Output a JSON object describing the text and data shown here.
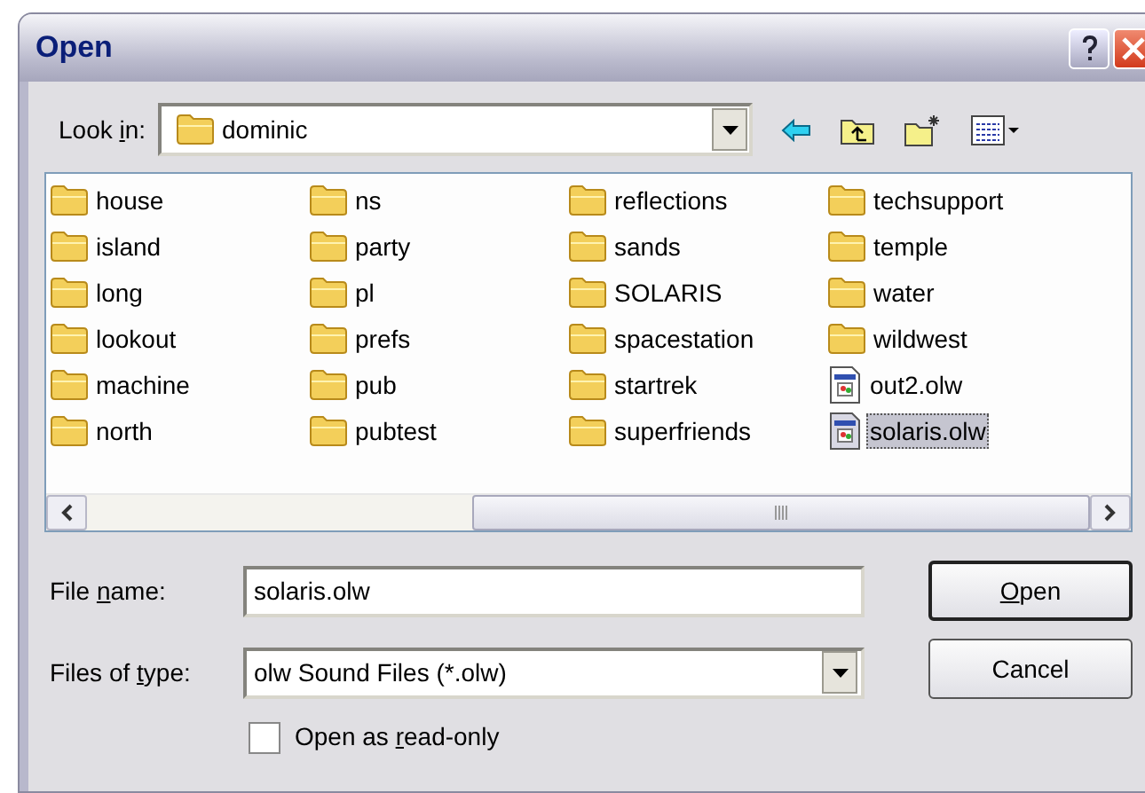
{
  "window": {
    "title": "Open"
  },
  "look_in": {
    "label_start": "Look ",
    "access_key": "i",
    "label_end": "n:",
    "value": "dominic"
  },
  "files": [
    {
      "name": "house",
      "kind": "folder",
      "selected": false
    },
    {
      "name": "island",
      "kind": "folder",
      "selected": false
    },
    {
      "name": "long",
      "kind": "folder",
      "selected": false
    },
    {
      "name": "lookout",
      "kind": "folder",
      "selected": false
    },
    {
      "name": "machine",
      "kind": "folder",
      "selected": false
    },
    {
      "name": "north",
      "kind": "folder",
      "selected": false
    },
    {
      "name": "ns",
      "kind": "folder",
      "selected": false
    },
    {
      "name": "party",
      "kind": "folder",
      "selected": false
    },
    {
      "name": "pl",
      "kind": "folder",
      "selected": false
    },
    {
      "name": "prefs",
      "kind": "folder",
      "selected": false
    },
    {
      "name": "pub",
      "kind": "folder",
      "selected": false
    },
    {
      "name": "pubtest",
      "kind": "folder",
      "selected": false
    },
    {
      "name": "reflections",
      "kind": "folder",
      "selected": false
    },
    {
      "name": "sands",
      "kind": "folder",
      "selected": false
    },
    {
      "name": "SOLARIS",
      "kind": "folder",
      "selected": false
    },
    {
      "name": "spacestation",
      "kind": "folder",
      "selected": false
    },
    {
      "name": "startrek",
      "kind": "folder",
      "selected": false
    },
    {
      "name": "superfriends",
      "kind": "folder",
      "selected": false
    },
    {
      "name": "techsupport",
      "kind": "folder",
      "selected": false
    },
    {
      "name": "temple",
      "kind": "folder",
      "selected": false
    },
    {
      "name": "water",
      "kind": "folder",
      "selected": false
    },
    {
      "name": "wildwest",
      "kind": "folder",
      "selected": false
    },
    {
      "name": "out2.olw",
      "kind": "file",
      "selected": false
    },
    {
      "name": "solaris.olw",
      "kind": "file",
      "selected": true
    }
  ],
  "file_name": {
    "label_start": "File ",
    "access_key": "n",
    "label_end": "ame:",
    "value": "solaris.olw"
  },
  "file_type": {
    "label_start": "Files of ",
    "access_key": "t",
    "label_end": "ype:",
    "value": "olw Sound Files (*.olw)"
  },
  "read_only": {
    "label_start": "Open as ",
    "access_key": "r",
    "label_end": "ead-only",
    "checked": false
  },
  "buttons": [
    {
      "access_key": "O",
      "label_end": "pen",
      "default": true
    },
    {
      "label_start": "Cancel",
      "default": false
    }
  ]
}
